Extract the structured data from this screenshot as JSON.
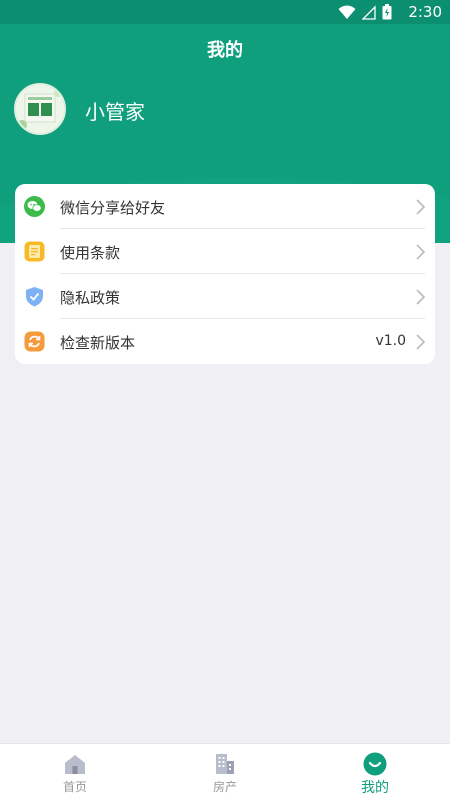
{
  "status_bar": {
    "time": "2:30"
  },
  "header": {
    "title": "我的"
  },
  "profile": {
    "username": "小管家"
  },
  "menu": [
    {
      "label": "微信分享给好友",
      "icon": "wechat-icon",
      "color": "#3dbb4a"
    },
    {
      "label": "使用条款",
      "icon": "document-icon",
      "color": "#f7b924"
    },
    {
      "label": "隐私政策",
      "icon": "shield-icon",
      "color": "#5b9df2"
    },
    {
      "label": "检查新版本",
      "icon": "refresh-icon",
      "color": "#f79a3c",
      "value": "v1.0"
    }
  ],
  "tabbar": {
    "tabs": [
      {
        "label": "首页",
        "icon": "home-icon",
        "active": false
      },
      {
        "label": "房产",
        "icon": "building-icon",
        "active": false
      },
      {
        "label": "我的",
        "icon": "profile-smile-icon",
        "active": true
      }
    ]
  },
  "colors": {
    "brand": "#0f9f7d",
    "background": "#efeff4"
  }
}
